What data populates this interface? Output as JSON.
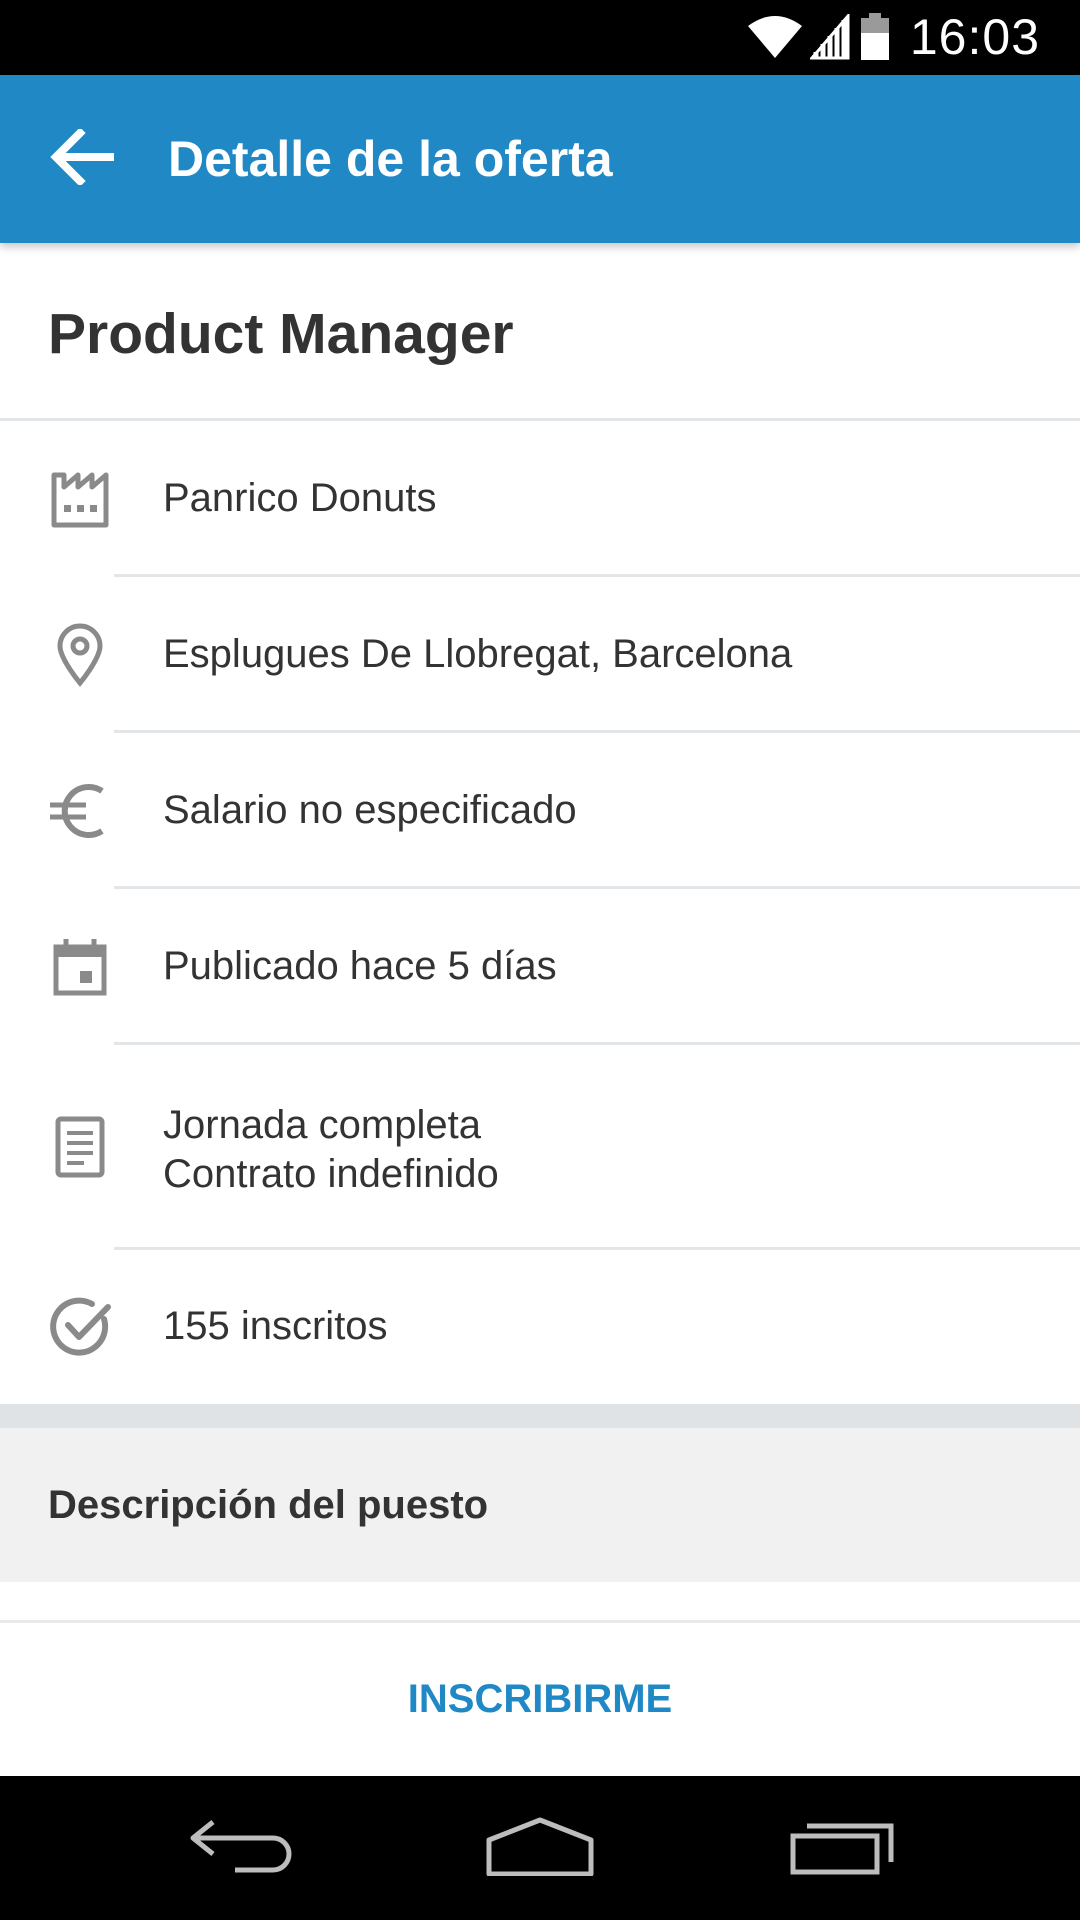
{
  "status_bar": {
    "time": "16:03",
    "icons": [
      "wifi-icon",
      "signal-icon",
      "battery-icon"
    ]
  },
  "app_bar": {
    "title": "Detalle de la oferta",
    "back_icon": "arrow-back-icon"
  },
  "job": {
    "title": "Product Manager"
  },
  "details": {
    "company": {
      "icon": "factory-icon",
      "text": "Panrico Donuts"
    },
    "location": {
      "icon": "location-pin-icon",
      "text": "Esplugues De Llobregat, Barcelona"
    },
    "salary": {
      "icon": "euro-icon",
      "text": "Salario no especificado"
    },
    "published": {
      "icon": "calendar-icon",
      "text": "Publicado hace 5 días"
    },
    "contract": {
      "icon": "document-icon",
      "line1": "Jornada completa",
      "line2": "Contrato indefinido"
    },
    "applicants": {
      "icon": "check-circle-icon",
      "text": "155 inscritos"
    }
  },
  "description": {
    "title": "Descripción del puesto"
  },
  "action": {
    "apply_label": "INSCRIBIRME"
  },
  "nav_bar": {
    "icons": [
      "nav-back-icon",
      "nav-home-icon",
      "nav-recents-icon"
    ]
  },
  "colors": {
    "primary": "#2088c4",
    "text": "#333333",
    "icon": "#8a8a8a",
    "divider": "#e3e6e8"
  }
}
